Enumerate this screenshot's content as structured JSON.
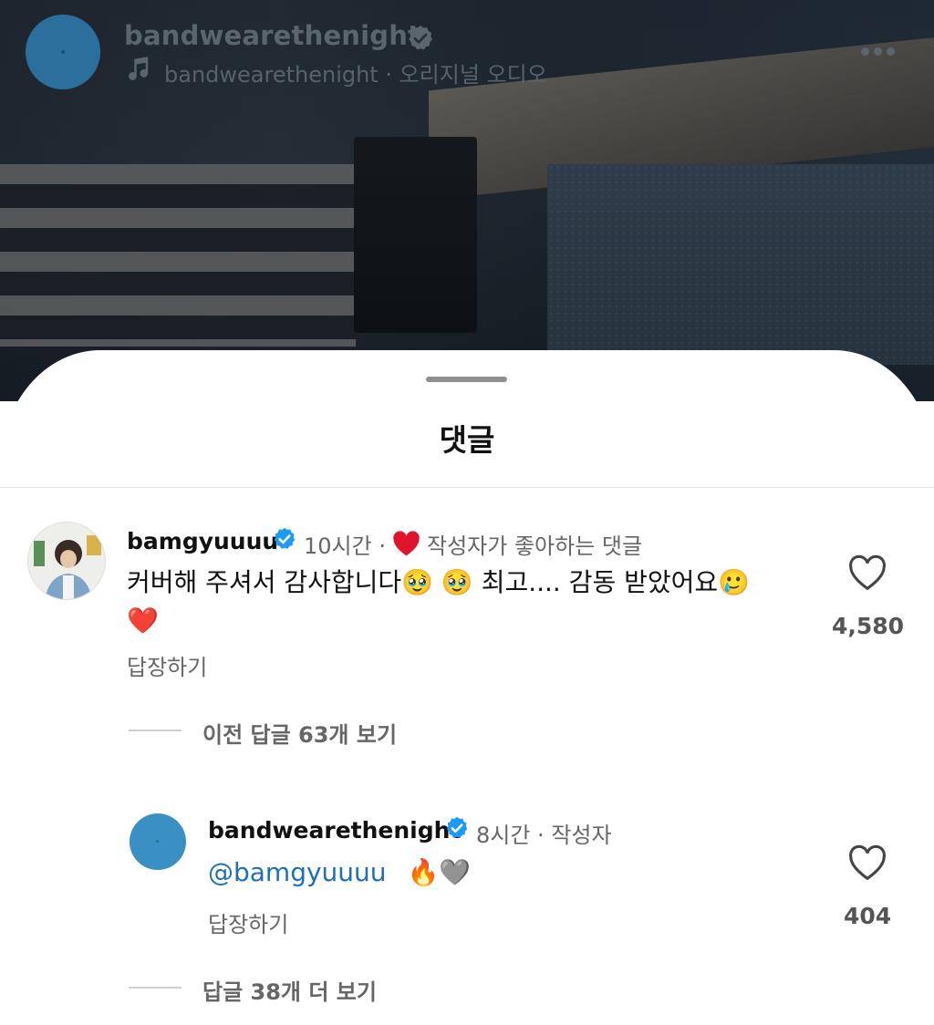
{
  "post": {
    "username": "bandwearethenight",
    "audio_label": "bandwearethenight · 오리지널 오디오"
  },
  "sheet": {
    "title": "댓글"
  },
  "comments": [
    {
      "username": "bamgyuuuu",
      "time": "10시간 ·",
      "liked_by_author_label": "작성자가 좋아하는 댓글",
      "text": "커버해 주셔서 감사합니다🥹 🥹 최고.... 감동 받았어요🥲",
      "emoji_line": "❤️",
      "reply_label": "답장하기",
      "like_count": "4,580",
      "view_replies_label": "이전 답글 63개 보기"
    }
  ],
  "replies": [
    {
      "username": "bandwearethenight",
      "meta": "8시간 · 작성자",
      "mention": "@bamgyuuuu",
      "text_suffix": "🔥🩶",
      "reply_label": "답장하기",
      "like_count": "404",
      "more_replies_label": "답글 38개 더 보기"
    }
  ],
  "colors": {
    "verified_blue": "#1d9bf0",
    "heart_red": "#e0142c",
    "mention_blue": "#1f6fb5"
  }
}
